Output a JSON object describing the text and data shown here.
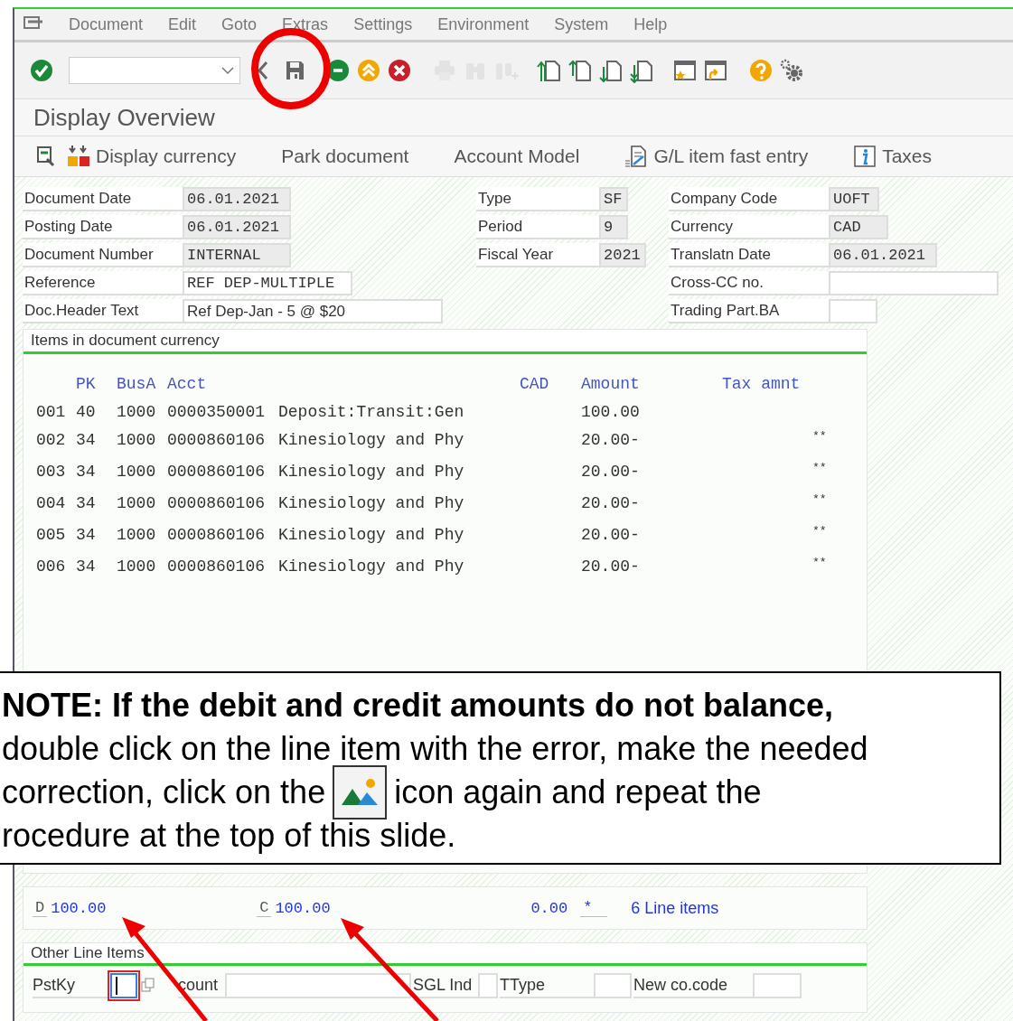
{
  "menu": [
    {
      "label": "Document"
    },
    {
      "label": "Edit"
    },
    {
      "label": "Goto"
    },
    {
      "label": "Extras"
    },
    {
      "label": "Settings"
    },
    {
      "label": "Environment"
    },
    {
      "label": "System"
    },
    {
      "label": "Help"
    }
  ],
  "toolbar": [
    {
      "kind": "ok",
      "disabled": false
    },
    {
      "kind": "command"
    },
    {
      "kind": "back",
      "disabled": false
    },
    {
      "kind": "save",
      "disabled": false
    },
    {
      "kind": "exit",
      "disabled": false
    },
    {
      "kind": "up",
      "disabled": false
    },
    {
      "kind": "cancel",
      "disabled": false
    },
    {
      "kind": "print",
      "disabled": true
    },
    {
      "kind": "find",
      "disabled": true
    },
    {
      "kind": "find-next",
      "disabled": true
    },
    {
      "kind": "first-page",
      "disabled": false
    },
    {
      "kind": "prev-page",
      "disabled": false
    },
    {
      "kind": "next-page",
      "disabled": false
    },
    {
      "kind": "last-page",
      "disabled": false
    },
    {
      "kind": "new-window",
      "disabled": false
    },
    {
      "kind": "shortcut",
      "disabled": false
    },
    {
      "kind": "help",
      "disabled": false
    },
    {
      "kind": "settings",
      "disabled": false
    }
  ],
  "title": "Display Overview",
  "app_toolbar": [
    {
      "kind": "icon-only"
    },
    {
      "kind": "currency",
      "label": "Display currency"
    },
    {
      "kind": "text",
      "label": "Park document"
    },
    {
      "kind": "text",
      "label": "Account Model"
    },
    {
      "kind": "fast-entry",
      "label": "G/L item fast entry"
    },
    {
      "kind": "info",
      "label": "Taxes"
    }
  ],
  "header_fields": [
    [
      {
        "label": "Document Date",
        "value": "06.01.2021",
        "editable": false
      },
      {
        "label": "Posting Date",
        "value": "06.01.2021",
        "editable": false
      },
      {
        "label": "Document Number",
        "value": "INTERNAL",
        "editable": false
      },
      {
        "label": "Reference",
        "value": "REF DEP-MULTIPLE",
        "editable": true
      },
      {
        "label": "Doc.Header Text",
        "value": "Ref Dep-Jan - 5 @ $20",
        "editable": true
      }
    ],
    [
      {
        "label": "Type",
        "value": "SF",
        "editable": false
      },
      {
        "label": "Period",
        "value": "9",
        "editable": false
      },
      {
        "label": "Fiscal Year",
        "value": "2021",
        "editable": false
      }
    ],
    [
      {
        "label": "Company Code",
        "value": "UOFT",
        "editable": false
      },
      {
        "label": "Currency",
        "value": "CAD",
        "editable": false
      },
      {
        "label": "Translatn Date",
        "value": "06.01.2021",
        "editable": false
      },
      {
        "label": "Cross-CC no.",
        "editable": true
      },
      {
        "label": "Trading Part.BA",
        "editable": true
      }
    ]
  ],
  "items": {
    "title": "Items in document currency",
    "columns": [
      "PK",
      "BusA",
      "Acct",
      "CAD",
      "Amount",
      "Tax amnt"
    ],
    "rows": [
      {
        "item": "001",
        "pk": "40",
        "busa": "1000",
        "acct": "0000350001",
        "text": "Deposit:Transit:Gen",
        "amount": "100.00"
      },
      {
        "item": "002",
        "pk": "34",
        "busa": "1000",
        "acct": "0000860106",
        "text": "Kinesiology and Phy",
        "amount": "20.00-",
        "flag": "**"
      },
      {
        "item": "003",
        "pk": "34",
        "busa": "1000",
        "acct": "0000860106",
        "text": "Kinesiology and Phy",
        "amount": "20.00-",
        "flag": "**"
      },
      {
        "item": "004",
        "pk": "34",
        "busa": "1000",
        "acct": "0000860106",
        "text": "Kinesiology and Phy",
        "amount": "20.00-",
        "flag": "**"
      },
      {
        "item": "005",
        "pk": "34",
        "busa": "1000",
        "acct": "0000860106",
        "text": "Kinesiology and Phy",
        "amount": "20.00-",
        "flag": "**"
      },
      {
        "item": "006",
        "pk": "34",
        "busa": "1000",
        "acct": "0000860106",
        "text": "Kinesiology and Phy",
        "amount": "20.00-",
        "flag": "**"
      }
    ]
  },
  "totals": {
    "debit_label": "D",
    "debit": "100.00",
    "credit_label": "C",
    "credit": "100.00",
    "balance": "0.00",
    "balance_flag": "*",
    "line_items": "6 Line items"
  },
  "other_items": {
    "title": "Other Line Items",
    "fields": [
      {
        "label": "PstKy",
        "focused": true
      },
      {
        "label": "count",
        "focused": false
      },
      {
        "label": "SGL Ind",
        "focused": false
      },
      {
        "label": "TType",
        "focused": false
      },
      {
        "label": "New co.code",
        "focused": false
      }
    ]
  },
  "note": {
    "heading": "NOTE: If the debit and credit amounts do not balance,",
    "line_2": "double click on the line item with the error, make the needed",
    "line_3_before": "correction, click on the",
    "line_3_after": "icon again and repeat the",
    "line_4": "rocedure at the top of this slide."
  }
}
